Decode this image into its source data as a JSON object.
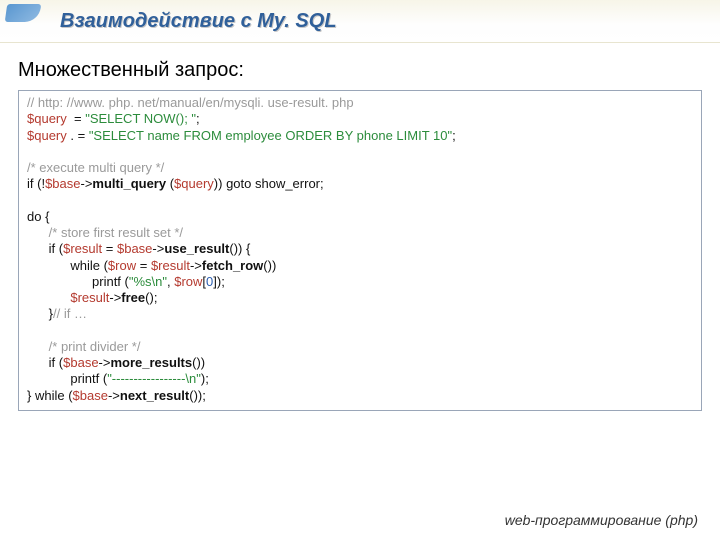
{
  "header": {
    "title": "Взаимодействие с My. SQL"
  },
  "section": {
    "title": "Множественный запрос:"
  },
  "code": {
    "l1a": "// http: //www. php. net/manual/en/mysqli. use-result. php",
    "l2a": "$query ",
    "l2b": " = ",
    "l2c": "\"SELECT NOW(); \"",
    "l2d": ";",
    "l3a": "$query ",
    "l3b": ". = ",
    "l3c": "\"SELECT name FROM employee ORDER BY phone LIMIT 10\"",
    "l3d": ";",
    "blank1": " ",
    "l4a": "/* execute multi query */",
    "l5a": "if (!",
    "l5b": "$base",
    "l5c": "->",
    "l5d": "multi_query ",
    "l5e": "(",
    "l5f": "$query",
    "l5g": ")) goto show_error;",
    "blank2": " ",
    "l6a": "do {",
    "l7a": "      /* store first result set */",
    "l8a": "      if (",
    "l8b": "$result ",
    "l8c": "= ",
    "l8d": "$base",
    "l8e": "->",
    "l8f": "use_result",
    "l8g": "()) {",
    "l9a": "            while (",
    "l9b": "$row ",
    "l9c": "= ",
    "l9d": "$result",
    "l9e": "->",
    "l9f": "fetch_row",
    "l9g": "())",
    "l10a": "                  printf (",
    "l10b": "\"%s\\n\"",
    "l10c": ", ",
    "l10d": "$row",
    "l10e": "[",
    "l10f": "0",
    "l10g": "]);",
    "l11a": "            ",
    "l11b": "$result",
    "l11c": "->",
    "l11d": "free",
    "l11e": "();",
    "l12a": "      }",
    "l12b": "// if …",
    "blank3": " ",
    "l13a": "      /* print divider */",
    "l14a": "      if (",
    "l14b": "$base",
    "l14c": "->",
    "l14d": "more_results",
    "l14e": "())",
    "l15a": "            printf (",
    "l15b": "\"-----------------\\n\"",
    "l15c": ");",
    "l16a": "} while (",
    "l16b": "$base",
    "l16c": "->",
    "l16d": "next_result",
    "l16e": "());"
  },
  "footer": {
    "text": "web-программирование (php)"
  }
}
